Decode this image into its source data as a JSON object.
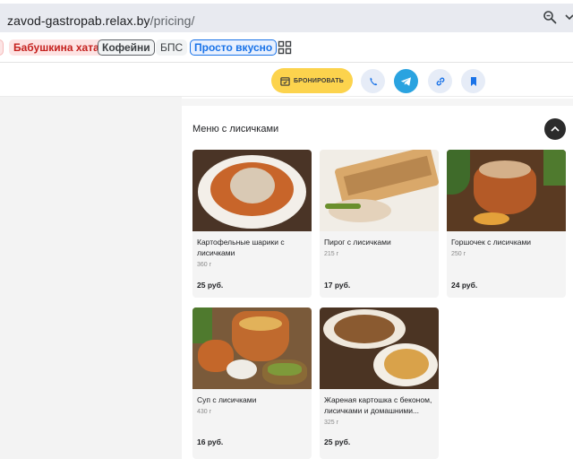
{
  "browser": {
    "url_host": "zavod-gastropab.relax.by",
    "url_path": "/pricing/",
    "icons": [
      "zoom-icon",
      "more-icon"
    ]
  },
  "bookmarks": {
    "items": [
      {
        "label": "Бабушкина хата"
      },
      {
        "label": "Кофейни"
      },
      {
        "label": "БПС"
      },
      {
        "label": "Просто вкусно"
      }
    ],
    "apps_icon": "grid-icon"
  },
  "header": {
    "book_label": "БРОНИРОВАТЬ",
    "accent_color": "#fcd34d",
    "telegram_color": "#2aa3e0",
    "icons": [
      "calendar-icon",
      "phone-icon",
      "telegram-icon",
      "link-icon",
      "bookmark-icon"
    ]
  },
  "section": {
    "title": "Меню с лисичками",
    "collapse_icon": "chevron-up-icon"
  },
  "menu": {
    "items": [
      {
        "name": "Картофельные шарики с лисичками",
        "weight": "360 г",
        "price": "25 руб."
      },
      {
        "name": "Пирог с лисичками",
        "weight": "215 г",
        "price": "17 руб."
      },
      {
        "name": "Горшочек с лисичками",
        "weight": "250 г",
        "price": "24 руб."
      },
      {
        "name": "Суп с лисичками",
        "weight": "430 г",
        "price": "16 руб."
      },
      {
        "name": "Жареная картошка с беконом, лисичками и домашними...",
        "weight": "325 г",
        "price": "25 руб."
      }
    ]
  }
}
